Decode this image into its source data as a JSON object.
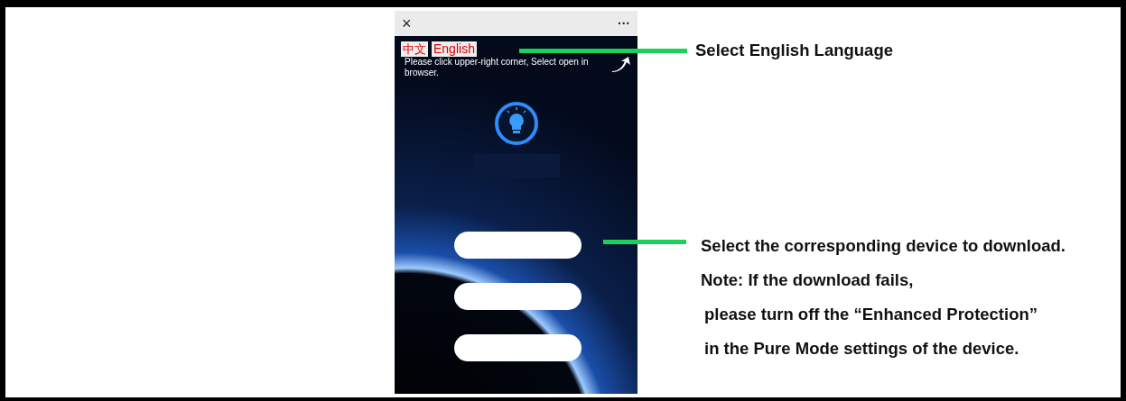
{
  "phone": {
    "top_bar": {
      "close": "×",
      "more": "···"
    },
    "languages": [
      {
        "label": "中文"
      },
      {
        "label": "English"
      }
    ],
    "hint": "Please click upper-right corner, Select open in browser."
  },
  "annotations": {
    "language": "Select English Language",
    "download": [
      "Select the corresponding device to download.",
      "Note: If the download fails,",
      "please turn off the “Enhanced Protection”",
      "in the Pure Mode settings of the device."
    ]
  }
}
